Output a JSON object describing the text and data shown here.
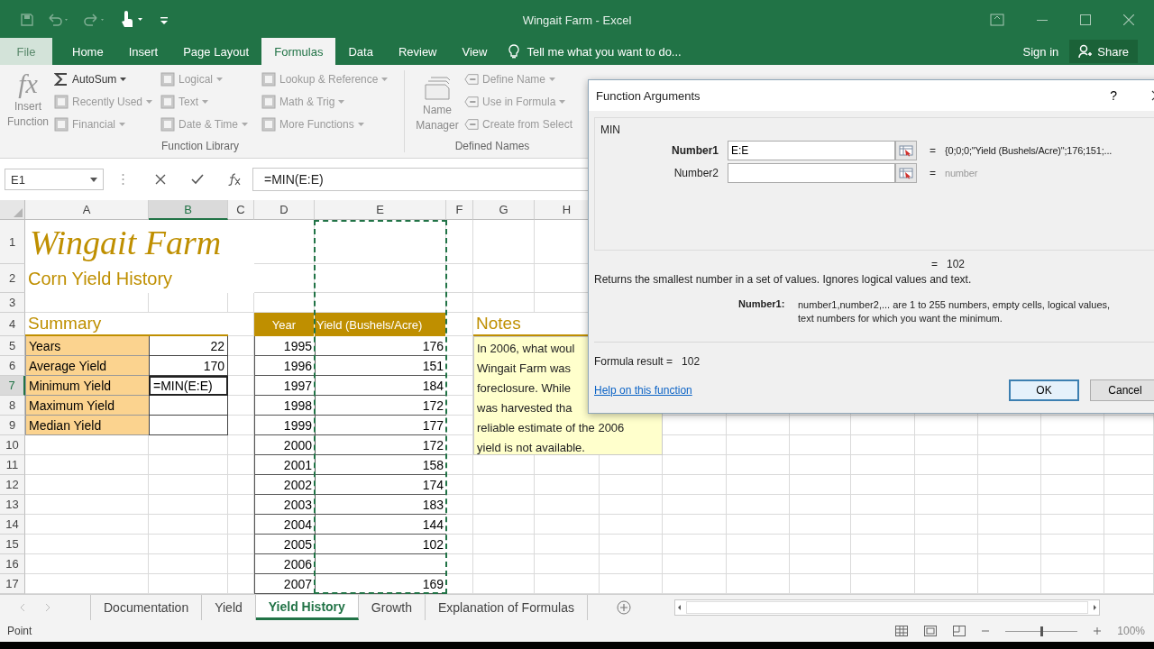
{
  "window": {
    "title": "Wingait Farm - Excel"
  },
  "ribbon_tabs": [
    {
      "label": "File",
      "kind": "file",
      "selected": false
    },
    {
      "label": "Home",
      "kind": "tab",
      "selected": false
    },
    {
      "label": "Insert",
      "kind": "tab",
      "selected": false
    },
    {
      "label": "Page Layout",
      "kind": "tab",
      "selected": false
    },
    {
      "label": "Formulas",
      "kind": "tab",
      "selected": true
    },
    {
      "label": "Data",
      "kind": "tab",
      "selected": false
    },
    {
      "label": "Review",
      "kind": "tab",
      "selected": false
    },
    {
      "label": "View",
      "kind": "tab",
      "selected": false
    }
  ],
  "tell_me": {
    "placeholder": "Tell me what you want to do..."
  },
  "account": {
    "sign_in": "Sign in",
    "share": "Share"
  },
  "ribbon": {
    "insert_function": {
      "icon": "fx",
      "label": "Insert Function",
      "disabled": true
    },
    "function_library": {
      "label": "Function Library",
      "columns": [
        {
          "items": [
            {
              "label": "AutoSum",
              "kind": "autosum",
              "dropdown": true,
              "disabled": false
            },
            {
              "label": "Recently Used",
              "kind": "category",
              "dropdown": true,
              "disabled": true
            },
            {
              "label": "Financial",
              "kind": "category",
              "dropdown": true,
              "disabled": true
            }
          ]
        },
        {
          "items": [
            {
              "label": "Logical",
              "kind": "category",
              "dropdown": true,
              "disabled": true
            },
            {
              "label": "Text",
              "kind": "category",
              "dropdown": true,
              "disabled": true
            },
            {
              "label": "Date & Time",
              "kind": "category",
              "dropdown": true,
              "disabled": true
            }
          ]
        },
        {
          "items": [
            {
              "label": "Lookup & Reference",
              "kind": "category",
              "dropdown": true,
              "disabled": true
            },
            {
              "label": "Math & Trig",
              "kind": "category",
              "dropdown": true,
              "disabled": true
            },
            {
              "label": "More Functions",
              "kind": "category",
              "dropdown": true,
              "disabled": true
            }
          ]
        }
      ]
    },
    "name_manager": {
      "label": "Name Manager",
      "disabled": true
    },
    "defined_names": {
      "label": "Defined Names",
      "items": [
        {
          "label": "Define Name",
          "dropdown": true,
          "disabled": true
        },
        {
          "label": "Use in Formula",
          "dropdown": true,
          "disabled": true
        },
        {
          "label": "Create from Select",
          "dropdown": false,
          "disabled": true
        }
      ]
    }
  },
  "formula_bar": {
    "name_box": "E1",
    "formula": "=MIN(E:E)"
  },
  "sheet": {
    "column_headers": [
      {
        "label": "A",
        "selected": false
      },
      {
        "label": "B",
        "selected": true
      },
      {
        "label": "C",
        "selected": false
      },
      {
        "label": "D",
        "selected": false
      },
      {
        "label": "E",
        "selected": false
      },
      {
        "label": "F",
        "selected": false
      },
      {
        "label": "G",
        "selected": false
      },
      {
        "label": "H",
        "selected": false
      }
    ],
    "row_headers": [
      {
        "label": "1",
        "selected": false
      },
      {
        "label": "2",
        "selected": false
      },
      {
        "label": "3",
        "selected": false
      },
      {
        "label": "4",
        "selected": false
      },
      {
        "label": "5",
        "selected": false
      },
      {
        "label": "6",
        "selected": false
      },
      {
        "label": "7",
        "selected": true
      },
      {
        "label": "8",
        "selected": false
      },
      {
        "label": "9",
        "selected": false
      },
      {
        "label": "10",
        "selected": false
      },
      {
        "label": "11",
        "selected": false
      },
      {
        "label": "12",
        "selected": false
      },
      {
        "label": "13",
        "selected": false
      },
      {
        "label": "14",
        "selected": false
      },
      {
        "label": "15",
        "selected": false
      },
      {
        "label": "16",
        "selected": false
      },
      {
        "label": "17",
        "selected": false
      }
    ],
    "title": "Wingait Farm",
    "subtitle": "Corn Yield History",
    "summary": {
      "heading": "Summary",
      "rows": [
        {
          "label": "Years",
          "value": "22",
          "active": false
        },
        {
          "label": "Average Yield",
          "value": "170",
          "active": false
        },
        {
          "label": "Minimum Yield",
          "value": "=MIN(E:E)",
          "active": true
        },
        {
          "label": "Maximum Yield",
          "active": false
        },
        {
          "label": "Median Yield",
          "active": false
        }
      ]
    },
    "yield_table": {
      "columns": [
        "Year",
        "Yield (Bushels/Acre)"
      ],
      "copy_marquee": true,
      "rows": [
        {
          "year": "1995",
          "yield": "176"
        },
        {
          "year": "1996",
          "yield": "151"
        },
        {
          "year": "1997",
          "yield": "184"
        },
        {
          "year": "1998",
          "yield": "172"
        },
        {
          "year": "1999",
          "yield": "177"
        },
        {
          "year": "2000",
          "yield": "172"
        },
        {
          "year": "2001",
          "yield": "158"
        },
        {
          "year": "2002",
          "yield": "174"
        },
        {
          "year": "2003",
          "yield": "183"
        },
        {
          "year": "2004",
          "yield": "144"
        },
        {
          "year": "2005",
          "yield": "102"
        },
        {
          "year": "2006"
        },
        {
          "year": "2007",
          "yield": "169"
        }
      ]
    },
    "notes": {
      "heading": "Notes",
      "lines": [
        "In 2006, what woul",
        "Wingait Farm was",
        "foreclosure. While",
        "was harvested tha",
        "reliable estimate of the 2006",
        "yield is not available."
      ]
    }
  },
  "dialog": {
    "title": "Function Arguments",
    "help": "?",
    "function_name": "MIN",
    "arguments": [
      {
        "label": "Number1",
        "value": "E:E",
        "equals": "=",
        "result": "{0;0;0;\"Yield (Bushels/Acre)\";176;151;...",
        "muted": false,
        "selected": true
      },
      {
        "label": "Number2",
        "equals": "=",
        "result": "number",
        "muted": true,
        "selected": false
      }
    ],
    "result_equals": "=",
    "result": "102",
    "description": "Returns the smallest number in a set of values. Ignores logical values and text.",
    "argument_help": {
      "label": "Number1:",
      "lines": [
        "number1,number2,... are 1 to 255 numbers, empty cells, logical values,",
        "text numbers for which you want the minimum."
      ]
    },
    "formula_result_label": "Formula result =",
    "formula_result": "102",
    "help_link": "Help on this function",
    "buttons": [
      {
        "label": "OK",
        "focused": true
      },
      {
        "label": "Cancel",
        "focused": false
      }
    ]
  },
  "sheet_tabs": [
    {
      "label": "Documentation",
      "selected": false
    },
    {
      "label": "Yield",
      "selected": false
    },
    {
      "label": "Yield History",
      "selected": true
    },
    {
      "label": "Growth",
      "selected": false
    },
    {
      "label": "Explanation of Formulas",
      "selected": false
    }
  ],
  "status_bar": {
    "mode": "Point",
    "zoom": {
      "label": "100%",
      "level": 0.5
    }
  }
}
